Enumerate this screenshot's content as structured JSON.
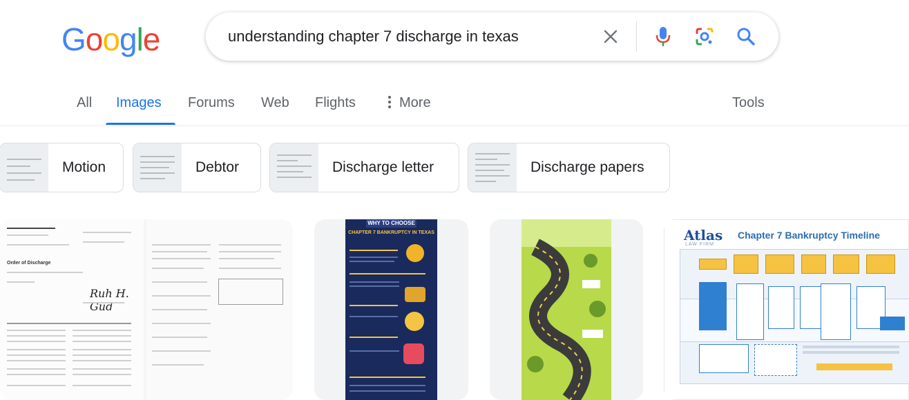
{
  "logo": {
    "letters": [
      "G",
      "o",
      "o",
      "g",
      "l",
      "e"
    ],
    "colors": [
      "#4285f4",
      "#ea4335",
      "#fbbc05",
      "#4285f4",
      "#34a853",
      "#ea4335"
    ]
  },
  "search": {
    "query": "understanding chapter 7 discharge in texas"
  },
  "tabs": [
    {
      "label": "All"
    },
    {
      "label": "Images"
    },
    {
      "label": "Forums"
    },
    {
      "label": "Web"
    },
    {
      "label": "Flights"
    },
    {
      "label": "More"
    }
  ],
  "tools_label": "Tools",
  "chips": [
    {
      "label": "Motion"
    },
    {
      "label": "Debtor"
    },
    {
      "label": "Discharge letter"
    },
    {
      "label": "Discharge papers"
    }
  ],
  "results": {
    "infographic": {
      "header": "WHY TO CHOOSE",
      "title": "CHAPTER 7 BANKRUPTCY IN TEXAS"
    },
    "timeline": {
      "brand": "Atlas",
      "brand_sub": "LAW FIRM",
      "title": "Chapter 7 Bankruptcy Timeline"
    },
    "doc": {
      "heading": "Order of Discharge"
    }
  },
  "colors": {
    "accent": "#1a73e8",
    "muted": "#5f6368"
  }
}
